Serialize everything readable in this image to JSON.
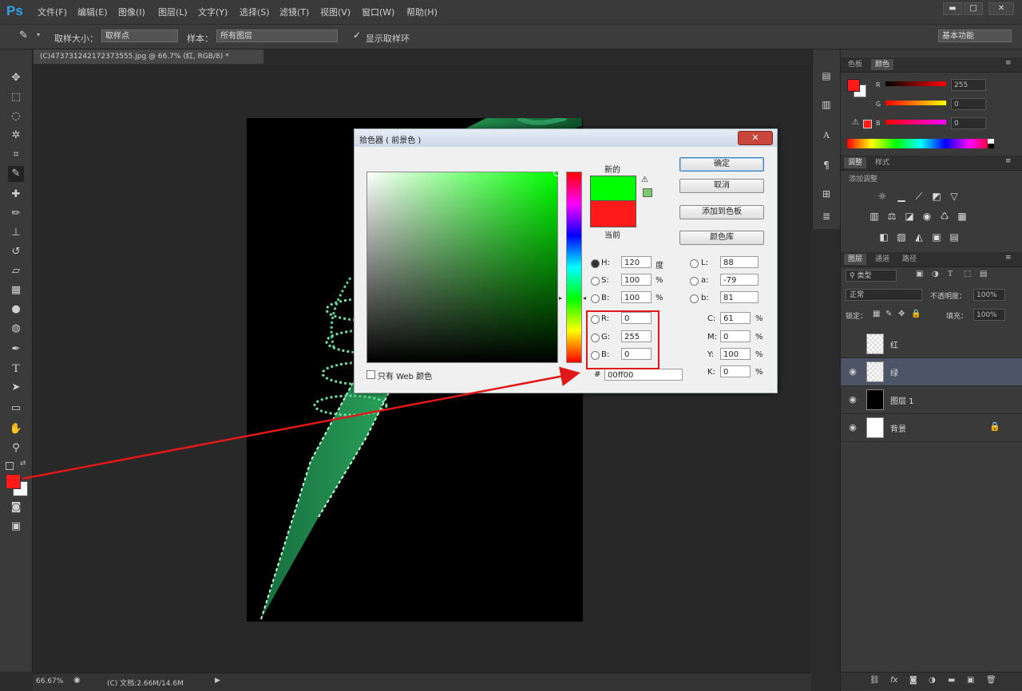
{
  "app": {
    "logo": "Ps"
  },
  "menu": [
    "文件(F)",
    "编辑(E)",
    "图像(I)",
    "图层(L)",
    "文字(Y)",
    "选择(S)",
    "滤镜(T)",
    "视图(V)",
    "窗口(W)",
    "帮助(H)"
  ],
  "window_controls": {
    "minimize": "▬",
    "maximize": "□",
    "close": "✕"
  },
  "options_bar": {
    "sample_size_label": "取样大小：",
    "sample_size_value": "取样点",
    "sample_label": "样本：",
    "sample_value": "所有图层",
    "show_ring_label": "显示取样环",
    "workspace": "基本功能"
  },
  "document_tab": {
    "title": "(C)473731242172373555.jpg @ 66.7% (红, RGB/8) *",
    "close": "×"
  },
  "status_bar": {
    "zoom": "66.67%",
    "doc_info": "(C) 文档:2.66M/14.6M"
  },
  "tools": [
    "move-tool",
    "marquee-tool",
    "lasso-tool",
    "magic-wand-tool",
    "crop-tool",
    "eyedropper-tool",
    "healing-brush-tool",
    "brush-tool",
    "clone-stamp-tool",
    "history-brush-tool",
    "eraser-tool",
    "gradient-tool",
    "blur-tool",
    "dodge-tool",
    "pen-tool",
    "type-tool",
    "path-selection-tool",
    "rectangle-tool",
    "hand-tool",
    "zoom-tool"
  ],
  "colors": {
    "foreground": "#ff1a1a",
    "background": "#ffffff",
    "new_color": "#00ff00",
    "current_color": "#ff1a1a",
    "highlight": "#e01818"
  },
  "color_picker": {
    "title": "拾色器 ( 前景色 )",
    "close": "✕",
    "new_label": "新的",
    "current_label": "当前",
    "buttons": {
      "ok": "确定",
      "cancel": "取消",
      "add_swatch": "添加到色板",
      "libraries": "颜色库"
    },
    "hsb": [
      {
        "label": "H:",
        "value": "120",
        "unit": "度"
      },
      {
        "label": "S:",
        "value": "100",
        "unit": "%"
      },
      {
        "label": "B:",
        "value": "100",
        "unit": "%"
      }
    ],
    "rgb": [
      {
        "label": "R:",
        "value": "0"
      },
      {
        "label": "G:",
        "value": "255"
      },
      {
        "label": "B:",
        "value": "0"
      }
    ],
    "lab": [
      {
        "label": "L:",
        "value": "88"
      },
      {
        "label": "a:",
        "value": "-79"
      },
      {
        "label": "b:",
        "value": "81"
      }
    ],
    "cmyk": [
      {
        "label": "C:",
        "value": "61",
        "unit": "%"
      },
      {
        "label": "M:",
        "value": "0",
        "unit": "%"
      },
      {
        "label": "Y:",
        "value": "100",
        "unit": "%"
      },
      {
        "label": "K:",
        "value": "0",
        "unit": "%"
      }
    ],
    "hash": "#",
    "hex": "00ff00",
    "web_only_label": "只有 Web 颜色"
  },
  "color_panel": {
    "tabs": [
      "色板",
      "颜色"
    ],
    "active_tab": "颜色",
    "sliders": [
      {
        "label": "R",
        "value": "255"
      },
      {
        "label": "G",
        "value": "0"
      },
      {
        "label": "B",
        "value": "0"
      }
    ]
  },
  "adjustments_panel": {
    "tabs": [
      "调整",
      "样式"
    ],
    "subtitle": "添加调整"
  },
  "layers_panel": {
    "tabs": [
      "图层",
      "通道",
      "路径"
    ],
    "filter_kind": "类型",
    "blend_mode": "正常",
    "opacity_label": "不透明度：",
    "opacity_value": "100%",
    "lock_label": "锁定：",
    "fill_label": "填充：",
    "fill_value": "100%",
    "layers": [
      {
        "name": "红",
        "visible": false,
        "selected": false
      },
      {
        "name": "绿",
        "visible": true,
        "selected": true
      },
      {
        "name": "图层 1",
        "visible": true,
        "selected": false
      },
      {
        "name": "背景",
        "visible": true,
        "selected": false
      }
    ],
    "footer_icons": [
      "link-icon",
      "fx-icon",
      "mask-icon",
      "adjustment-icon",
      "group-icon",
      "new-layer-icon",
      "trash-icon"
    ],
    "footer_fx": "fx"
  }
}
